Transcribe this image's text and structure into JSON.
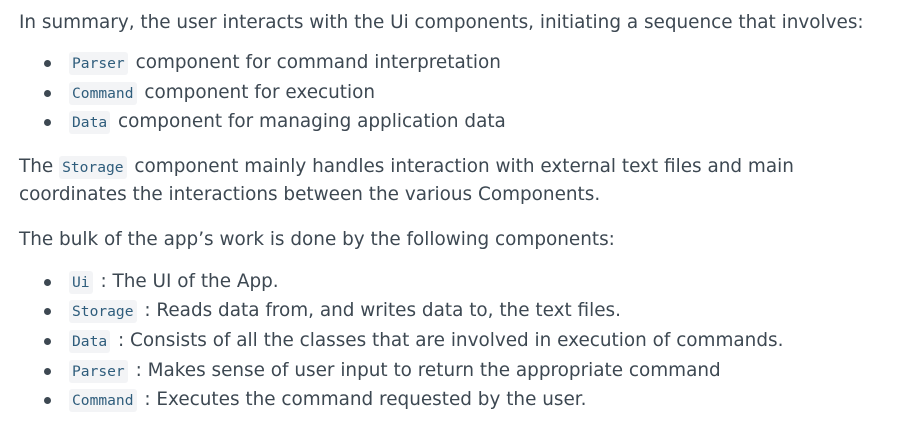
{
  "summary_text": "In summary, the user interacts with the Ui components, initiating a sequence that involves:",
  "sequence_items": [
    {
      "code": "Parser",
      "text": "component for command interpretation"
    },
    {
      "code": "Command",
      "text": "component for execution"
    },
    {
      "code": "Data",
      "text": "component for managing application data"
    }
  ],
  "storage_paragraph": {
    "before": "The ",
    "code": "Storage",
    "after": " component mainly handles interaction with external text files and main coordinates the interactions between the various Components."
  },
  "bulk_text": "The bulk of the app’s work is done by the following components:",
  "component_items": [
    {
      "code": "Ui",
      "text": ": The UI of the App."
    },
    {
      "code": "Storage",
      "text": ": Reads data from, and writes data to, the text files."
    },
    {
      "code": "Data",
      "text": ": Consists of all the classes that are involved in execution of commands."
    },
    {
      "code": "Parser",
      "text": ": Makes sense of user input to return the appropriate command"
    },
    {
      "code": "Command",
      "text": ": Executes the command requested by the user."
    }
  ]
}
